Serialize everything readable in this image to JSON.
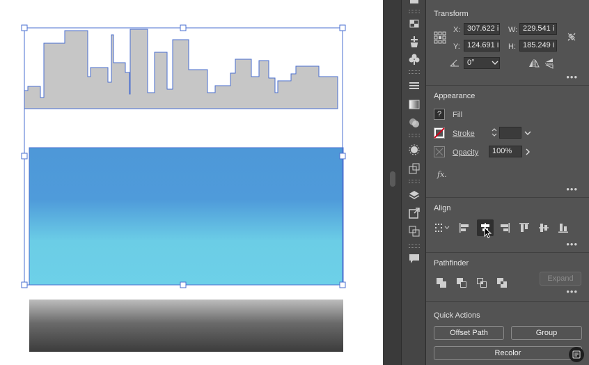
{
  "transform": {
    "title": "Transform",
    "x_label": "X:",
    "x_value": "307.622 i",
    "y_label": "Y:",
    "y_value": "124.691 i",
    "w_label": "W:",
    "w_value": "229.541 i",
    "h_label": "H:",
    "h_value": "185.249 i",
    "angle_value": "0°"
  },
  "appearance": {
    "title": "Appearance",
    "fill_label": "Fill",
    "fill_swatch": "?",
    "stroke_label": "Stroke",
    "stroke_value": "",
    "opacity_label": "Opacity",
    "opacity_value": "100%",
    "fx_label": "fx."
  },
  "align": {
    "title": "Align"
  },
  "pathfinder": {
    "title": "Pathfinder",
    "expand_label": "Expand"
  },
  "quick_actions": {
    "title": "Quick Actions",
    "offset_path_label": "Offset Path",
    "group_label": "Group",
    "recolor_label": "Recolor"
  },
  "more_label": "•••",
  "colors": {
    "panel_bg": "#535353",
    "skyline_fill": "#c8c8c8",
    "selection": "#4a6fd0",
    "sky_top": "#4d98d8",
    "sky_bottom": "#6ccfe6",
    "ground_top": "#b8b8b8",
    "ground_bottom": "#3e3e3e"
  }
}
